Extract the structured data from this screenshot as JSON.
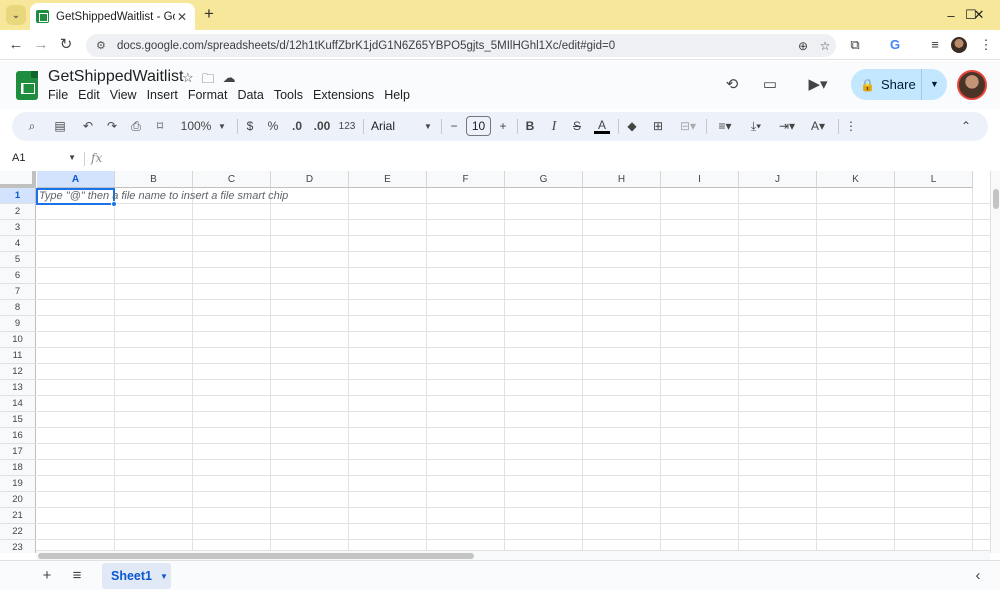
{
  "browser": {
    "tab_title": "GetShippedWaitlist - Google Sh",
    "new_tab": "+",
    "url": "docs.google.com/spreadsheets/d/12h1tKuffZbrK1jdG1N6Z65YBPO5gjts_5MIlHGhl1Xc/edit#gid=0",
    "window_controls": {
      "minimize": "–",
      "maximize": "☐",
      "close": "✕"
    }
  },
  "doc": {
    "title": "GetShippedWaitlist",
    "menus": [
      "File",
      "Edit",
      "View",
      "Insert",
      "Format",
      "Data",
      "Tools",
      "Extensions",
      "Help"
    ],
    "share_label": "Share"
  },
  "toolbar": {
    "zoom": "100%",
    "currency": "$",
    "percent": "%",
    "dec_decrease": ".0",
    "dec_increase": ".00",
    "number_format": "123",
    "font": "Arial",
    "font_size": "10",
    "bold": "B",
    "italic": "I",
    "strikethrough": "S",
    "text_color": "A",
    "text_rotate": "A"
  },
  "formula_bar": {
    "name_box": "A1",
    "fx": "fx"
  },
  "grid": {
    "columns": [
      "A",
      "B",
      "C",
      "D",
      "E",
      "F",
      "G",
      "H",
      "I",
      "J",
      "K",
      "L"
    ],
    "rows": [
      "1",
      "2",
      "3",
      "4",
      "5",
      "6",
      "7",
      "8",
      "9",
      "10",
      "11",
      "12",
      "13",
      "14",
      "15",
      "16",
      "17",
      "18",
      "19",
      "20",
      "21",
      "22",
      "23"
    ],
    "selected_cell": "A1",
    "cell_hint": "Type \"@\" then a file name to insert a file smart chip"
  },
  "sheets": {
    "active": "Sheet1"
  },
  "colors": {
    "accent": "#1a73e8",
    "share_bg": "#c2e7ff",
    "tabstrip": "#f6e79a",
    "sheets_green": "#1e8e3e"
  }
}
